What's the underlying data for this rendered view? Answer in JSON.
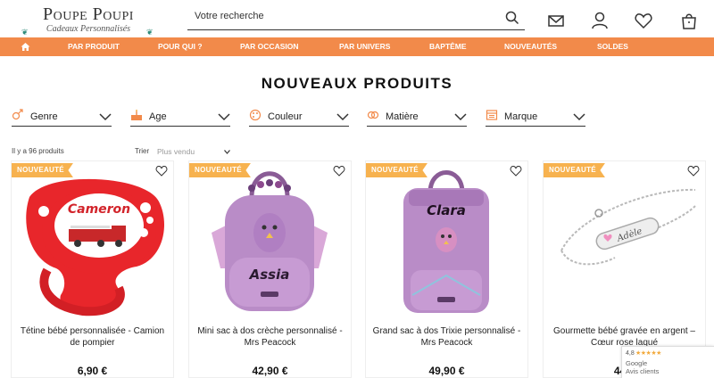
{
  "brand": {
    "title": "Poupe Poupi",
    "subtitle": "Cadeaux Personnalisés"
  },
  "search": {
    "placeholder": "Votre recherche"
  },
  "header_icons": [
    "mail-icon",
    "account-icon",
    "heart-icon",
    "cart-icon"
  ],
  "nav": {
    "items": [
      "PAR PRODUIT",
      "POUR QUI ?",
      "PAR OCCASION",
      "PAR UNIVERS",
      "BAPTÊME",
      "NOUVEAUTÉS",
      "SOLDES"
    ]
  },
  "page": {
    "title": "NOUVEAUX PRODUITS",
    "count": "Il y a 96 produits",
    "sort_label": "Trier",
    "sort_value": "Plus vendu"
  },
  "filters": [
    {
      "label": "Genre",
      "icon": "gender-icon"
    },
    {
      "label": "Age",
      "icon": "cake-icon"
    },
    {
      "label": "Couleur",
      "icon": "palette-icon"
    },
    {
      "label": "Matière",
      "icon": "fabric-icon"
    },
    {
      "label": "Marque",
      "icon": "brand-icon"
    }
  ],
  "products": [
    {
      "badge": "NOUVEAUTÉ",
      "name": "Tétine bébé personnalisée - Camion de pompier",
      "price": "6,90 €",
      "text_on_item": "Cameron"
    },
    {
      "badge": "NOUVEAUTÉ",
      "name": "Mini sac à dos crèche personnalisé - Mrs Peacock",
      "price": "42,90 €",
      "text_on_item": "Assia"
    },
    {
      "badge": "NOUVEAUTÉ",
      "name": "Grand sac à dos Trixie personnalisé - Mrs Peacock",
      "price": "49,90 €",
      "text_on_item": "Clara"
    },
    {
      "badge": "NOUVEAUTÉ",
      "name": "Gourmette bébé gravée en argent – Cœur rose laqué",
      "price": "44,9",
      "text_on_item": "Adèle"
    }
  ],
  "google_badge": {
    "rating": "4,8",
    "stars": "★★★★★",
    "name": "Google",
    "sub": "Avis clients"
  },
  "colors": {
    "nav": "#f28a4a",
    "badge": "#f7b24f",
    "pacifier": "#e8262b",
    "backpack": "#b98cc7"
  }
}
